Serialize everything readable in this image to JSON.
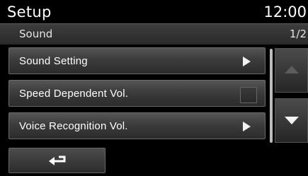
{
  "header": {
    "title": "Setup",
    "clock": "12:00"
  },
  "subheader": {
    "title": "Sound",
    "page": "1/2"
  },
  "menu": {
    "items": [
      {
        "label": "Sound Setting",
        "control": "arrow"
      },
      {
        "label": "Speed Dependent Vol.",
        "control": "checkbox",
        "checked": false
      },
      {
        "label": "Voice Recognition Vol.",
        "control": "arrow"
      }
    ]
  },
  "icons": {
    "item_arrow": "arrow-right-icon",
    "scroll_up": "triangle-up-icon",
    "scroll_down": "triangle-down-icon",
    "back": "return-arrow-icon"
  },
  "colors": {
    "background": "#000000",
    "item_gradient_top": "#555555",
    "item_gradient_bottom": "#2b2b2b",
    "scroll_up_disabled": "#5c5c5c",
    "text": "#ffffff"
  },
  "scroll": {
    "up_enabled": false,
    "down_enabled": true
  }
}
